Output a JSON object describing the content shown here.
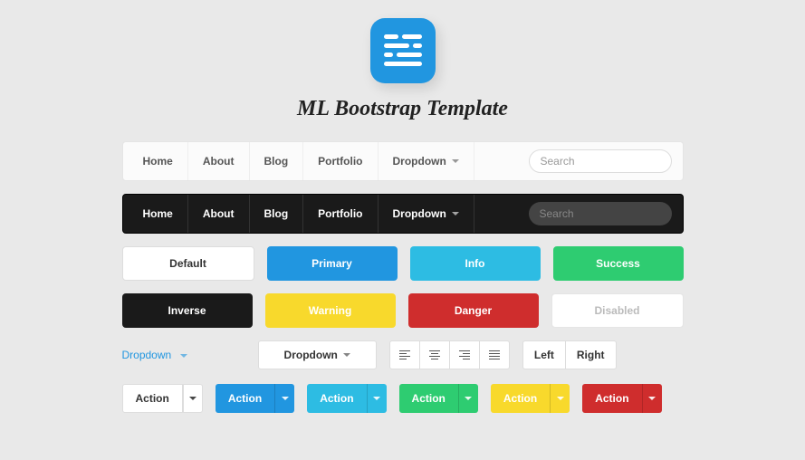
{
  "title": "ML Bootstrap Template",
  "nav": {
    "items": [
      "Home",
      "About",
      "Blog",
      "Portfolio",
      "Dropdown"
    ],
    "search_placeholder": "Search"
  },
  "buttons_row1": {
    "default": "Default",
    "primary": "Primary",
    "info": "Info",
    "success": "Success"
  },
  "buttons_row2": {
    "inverse": "Inverse",
    "warning": "Warning",
    "danger": "Danger",
    "disabled": "Disabled"
  },
  "dropdowns": {
    "link_label": "Dropdown",
    "button_label": "Dropdown"
  },
  "segments": {
    "left": "Left",
    "right": "Right"
  },
  "split_label": "Action",
  "colors": {
    "primary": "#2196e0",
    "info": "#2dbce3",
    "success": "#2ecc71",
    "warning": "#f8d92c",
    "danger": "#cf2d2d",
    "inverse": "#1a1a1a"
  }
}
